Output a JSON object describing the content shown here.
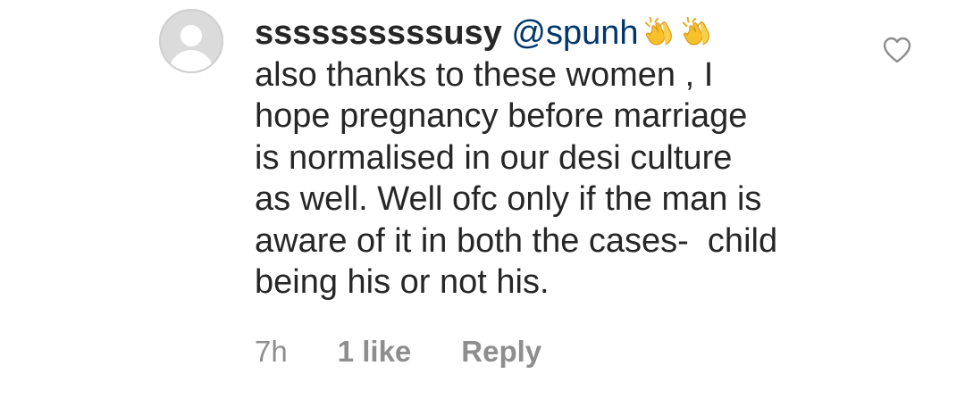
{
  "comment": {
    "username": "ssssssssssusy",
    "mention": "@spunh",
    "emojis": [
      "clapping-hands",
      "clapping-hands"
    ],
    "lines": [
      "also thanks to these women , I",
      "hope pregnancy before marriage",
      "is normalised in our desi culture",
      "as well. Well ofc only if the man is",
      "aware of it in both the cases-  child",
      "being his or not his."
    ],
    "time": "7h",
    "likes": "1 like",
    "reply_label": "Reply"
  },
  "colors": {
    "text": "#262626",
    "mention": "#00376b",
    "meta": "#8e8e8e",
    "emoji": "#f7c12a"
  },
  "icons": {
    "like": "heart-outline-icon",
    "avatar": "default-profile-icon"
  }
}
